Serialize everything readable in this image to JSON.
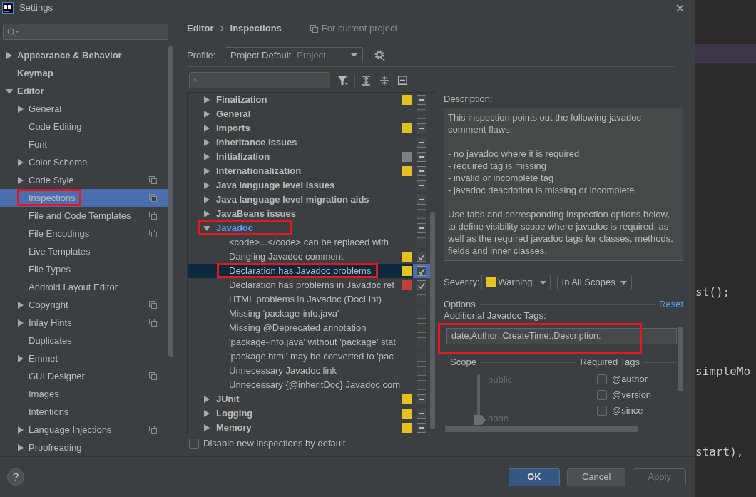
{
  "window": {
    "title": "Settings"
  },
  "sidebar": {
    "items": [
      {
        "label": "Appearance & Behavior",
        "kind": "folder",
        "expanded": false,
        "selected": false,
        "project_scoped": false,
        "annotated": false
      },
      {
        "label": "Keymap",
        "kind": "leaf",
        "selected": false,
        "project_scoped": false,
        "annotated": false
      },
      {
        "label": "Editor",
        "kind": "folder",
        "expanded": true,
        "selected": false,
        "project_scoped": false,
        "annotated": false,
        "children": [
          {
            "label": "General",
            "kind": "folder",
            "expanded": false,
            "selected": false,
            "project_scoped": false,
            "annotated": false
          },
          {
            "label": "Code Editing",
            "kind": "leaf",
            "selected": false,
            "project_scoped": false,
            "annotated": false
          },
          {
            "label": "Font",
            "kind": "leaf",
            "selected": false,
            "project_scoped": false,
            "annotated": false
          },
          {
            "label": "Color Scheme",
            "kind": "folder",
            "expanded": false,
            "selected": false,
            "project_scoped": false,
            "annotated": false
          },
          {
            "label": "Code Style",
            "kind": "folder",
            "expanded": false,
            "selected": false,
            "project_scoped": true,
            "annotated": false
          },
          {
            "label": "Inspections",
            "kind": "leaf",
            "selected": true,
            "project_scoped": true,
            "annotated": true
          },
          {
            "label": "File and Code Templates",
            "kind": "leaf",
            "selected": false,
            "project_scoped": true,
            "annotated": false
          },
          {
            "label": "File Encodings",
            "kind": "leaf",
            "selected": false,
            "project_scoped": true,
            "annotated": false
          },
          {
            "label": "Live Templates",
            "kind": "leaf",
            "selected": false,
            "project_scoped": false,
            "annotated": false
          },
          {
            "label": "File Types",
            "kind": "leaf",
            "selected": false,
            "project_scoped": false,
            "annotated": false
          },
          {
            "label": "Android Layout Editor",
            "kind": "leaf",
            "selected": false,
            "project_scoped": false,
            "annotated": false
          },
          {
            "label": "Copyright",
            "kind": "folder",
            "expanded": false,
            "selected": false,
            "project_scoped": true,
            "annotated": false
          },
          {
            "label": "Inlay Hints",
            "kind": "folder",
            "expanded": false,
            "selected": false,
            "project_scoped": true,
            "annotated": false
          },
          {
            "label": "Duplicates",
            "kind": "leaf",
            "selected": false,
            "project_scoped": false,
            "annotated": false
          },
          {
            "label": "Emmet",
            "kind": "folder",
            "expanded": false,
            "selected": false,
            "project_scoped": false,
            "annotated": false
          },
          {
            "label": "GUI Designer",
            "kind": "leaf",
            "selected": false,
            "project_scoped": true,
            "annotated": false
          },
          {
            "label": "Images",
            "kind": "leaf",
            "selected": false,
            "project_scoped": false,
            "annotated": false
          },
          {
            "label": "Intentions",
            "kind": "leaf",
            "selected": false,
            "project_scoped": false,
            "annotated": false
          },
          {
            "label": "Language Injections",
            "kind": "folder",
            "expanded": false,
            "selected": false,
            "project_scoped": true,
            "annotated": false
          },
          {
            "label": "Proofreading",
            "kind": "folder",
            "expanded": false,
            "selected": false,
            "project_scoped": false,
            "annotated": false
          }
        ]
      }
    ]
  },
  "breadcrumb": [
    "Editor",
    "Inspections"
  ],
  "scope_note": "For current project",
  "profile": {
    "label": "Profile:",
    "value": "Project Default",
    "hint": "Project"
  },
  "tree": {
    "items": [
      {
        "label": "Finalization",
        "kind": "group",
        "expanded": false,
        "color": "#e4c021",
        "checked": true,
        "partial": true,
        "selected": false,
        "annotated": false
      },
      {
        "label": "General",
        "kind": "group",
        "expanded": false,
        "checked": false,
        "partial": false,
        "selected": false,
        "annotated": false
      },
      {
        "label": "Imports",
        "kind": "group",
        "expanded": false,
        "color": "#e4c021",
        "checked": true,
        "partial": true,
        "selected": false,
        "annotated": false
      },
      {
        "label": "Inheritance issues",
        "kind": "group",
        "expanded": false,
        "checked": true,
        "partial": true,
        "selected": false,
        "annotated": false
      },
      {
        "label": "Initialization",
        "kind": "group",
        "expanded": false,
        "color": "#808080",
        "checked": true,
        "partial": true,
        "selected": false,
        "annotated": false
      },
      {
        "label": "Internationalization",
        "kind": "group",
        "expanded": false,
        "color": "#e4c021",
        "checked": true,
        "partial": true,
        "selected": false,
        "annotated": false
      },
      {
        "label": "Java language level issues",
        "kind": "group",
        "expanded": false,
        "checked": true,
        "partial": true,
        "selected": false,
        "annotated": false
      },
      {
        "label": "Java language level migration aids",
        "kind": "group",
        "expanded": false,
        "checked": true,
        "partial": true,
        "selected": false,
        "annotated": false
      },
      {
        "label": "JavaBeans issues",
        "kind": "group",
        "expanded": false,
        "checked": false,
        "partial": false,
        "selected": false,
        "annotated": false
      },
      {
        "label": "Javadoc",
        "kind": "group",
        "expanded": true,
        "checked": true,
        "partial": true,
        "selected": false,
        "annotated": true,
        "children": [
          {
            "label": "<code>...</code> can be replaced with",
            "kind": "item",
            "checked": false,
            "partial": false,
            "selected": false,
            "annotated": false
          },
          {
            "label": "Dangling Javadoc comment",
            "kind": "item",
            "color": "#e4c021",
            "checked": true,
            "partial": false,
            "selected": false,
            "annotated": false
          },
          {
            "label": "Declaration has Javadoc problems",
            "kind": "item",
            "color": "#e4c021",
            "checked": true,
            "partial": false,
            "selected": true,
            "annotated": true
          },
          {
            "label": "Declaration has problems in Javadoc ref",
            "kind": "item",
            "color": "#c0413c",
            "checked": true,
            "partial": false,
            "selected": false,
            "annotated": false
          },
          {
            "label": "HTML problems in Javadoc (DocLint)",
            "kind": "item",
            "checked": false,
            "partial": false,
            "selected": false,
            "annotated": false
          },
          {
            "label": "Missing 'package-info.java'",
            "kind": "item",
            "checked": false,
            "partial": false,
            "selected": false,
            "annotated": false
          },
          {
            "label": "Missing @Deprecated annotation",
            "kind": "item",
            "checked": false,
            "partial": false,
            "selected": false,
            "annotated": false
          },
          {
            "label": "'package-info.java' without 'package' stat",
            "kind": "item",
            "checked": false,
            "partial": false,
            "selected": false,
            "annotated": false
          },
          {
            "label": "'package.html' may be converted to 'pac",
            "kind": "item",
            "checked": false,
            "partial": false,
            "selected": false,
            "annotated": false
          },
          {
            "label": "Unnecessary Javadoc link",
            "kind": "item",
            "checked": false,
            "partial": false,
            "selected": false,
            "annotated": false
          },
          {
            "label": "Unnecessary {@inheritDoc} Javadoc com",
            "kind": "item",
            "checked": false,
            "partial": false,
            "selected": false,
            "annotated": false
          }
        ]
      },
      {
        "label": "JUnit",
        "kind": "group",
        "expanded": false,
        "color": "#e4c021",
        "checked": true,
        "partial": true,
        "selected": false,
        "annotated": false
      },
      {
        "label": "Logging",
        "kind": "group",
        "expanded": false,
        "color": "#e4c021",
        "checked": true,
        "partial": true,
        "selected": false,
        "annotated": false
      },
      {
        "label": "Memory",
        "kind": "group",
        "expanded": false,
        "color": "#e4c021",
        "checked": true,
        "partial": true,
        "selected": false,
        "annotated": false
      }
    ]
  },
  "disable_new": {
    "label": "Disable new inspections by default",
    "checked": false
  },
  "description": {
    "label": "Description:",
    "text": "This inspection points out the following javadoc comment flaws:\n\n - no javadoc where it is required\n - required tag is missing\n - invalid or incomplete tag\n - javadoc description is missing or incomplete\n\nUse tabs and corresponding inspection options below, to define visibility scope where javadoc is required, as well as the required javadoc tags for classes, methods, fields and inner classes."
  },
  "severity": {
    "label": "Severity:",
    "value": "Warning",
    "color": "#e4c021",
    "scope": "In All Scopes"
  },
  "options": {
    "label": "Options",
    "reset": "Reset",
    "tags_label": "Additional Javadoc Tags:",
    "tags_value": "date,Author:,CreateTime:,Description:",
    "tags_annotated": true,
    "scope_label": "Scope",
    "required_label": "Required Tags",
    "scope_slider": {
      "top": "public",
      "bottom": "none",
      "level": 0
    },
    "required_tags": [
      {
        "label": "@author",
        "checked": false
      },
      {
        "label": "@version",
        "checked": false
      },
      {
        "label": "@since",
        "checked": false
      }
    ]
  },
  "buttons": [
    {
      "label": "OK",
      "kind": "primary",
      "disabled": false
    },
    {
      "label": "Cancel",
      "kind": "normal",
      "disabled": false
    },
    {
      "label": "Apply",
      "kind": "normal",
      "disabled": true
    }
  ],
  "editor": {
    "lines": [
      "st();",
      "simpleMo",
      "start),"
    ]
  }
}
